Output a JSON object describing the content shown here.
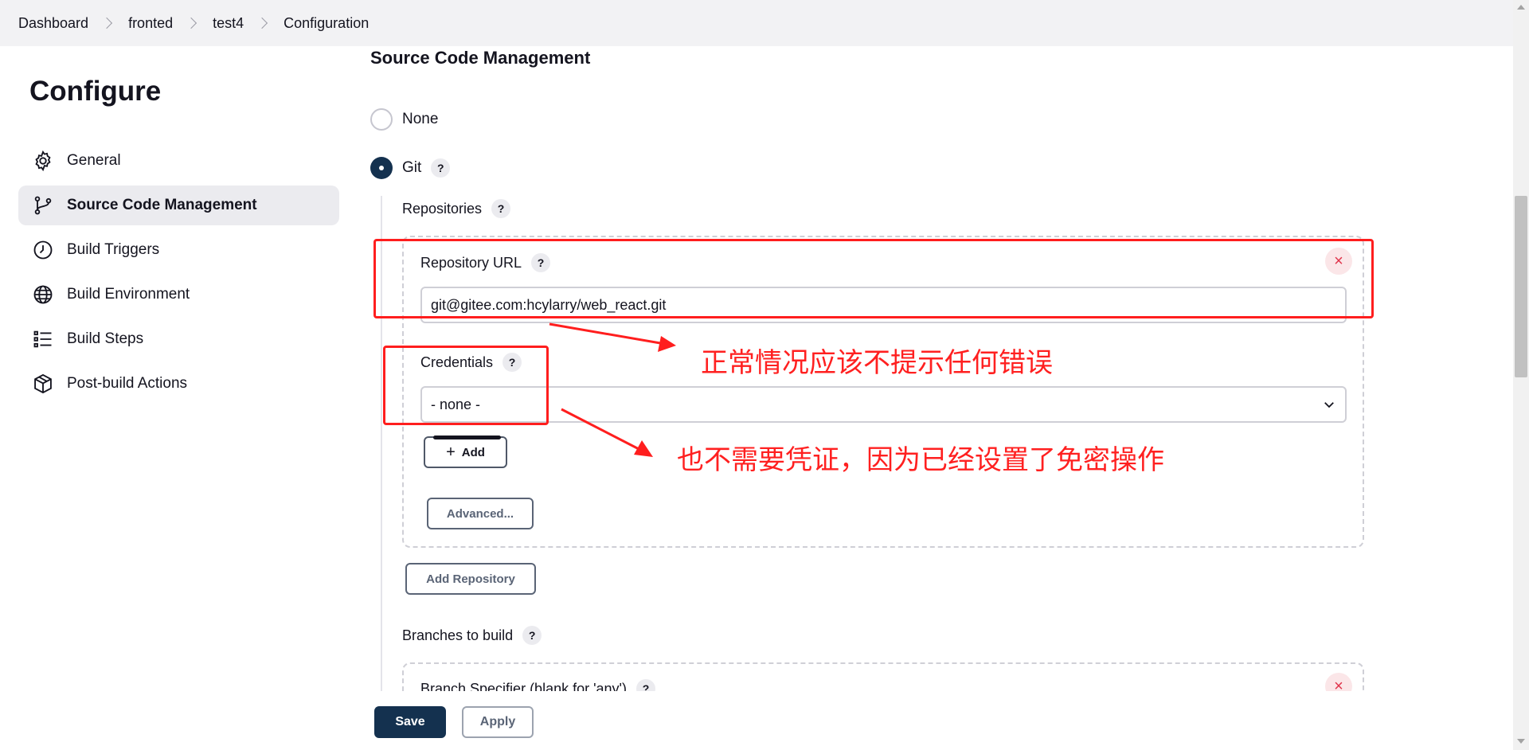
{
  "breadcrumb": [
    "Dashboard",
    "fronted",
    "test4",
    "Configuration"
  ],
  "page_title": "Configure",
  "sidebar": {
    "items": [
      {
        "label": "General",
        "icon": "gear-icon"
      },
      {
        "label": "Source Code Management",
        "icon": "git-branch-icon",
        "active": true
      },
      {
        "label": "Build Triggers",
        "icon": "clock-icon"
      },
      {
        "label": "Build Environment",
        "icon": "globe-icon"
      },
      {
        "label": "Build Steps",
        "icon": "list-icon"
      },
      {
        "label": "Post-build Actions",
        "icon": "package-icon"
      }
    ]
  },
  "scm": {
    "title": "Source Code Management",
    "option_none": "None",
    "option_git": "Git",
    "selected": "Git",
    "repositories_label": "Repositories",
    "repository_url_label": "Repository URL",
    "repository_url_value": "git@gitee.com:hcylarry/web_react.git",
    "credentials_label": "Credentials",
    "credentials_value": "- none -",
    "add_label": "Add",
    "advanced_label": "Advanced...",
    "add_repository_label": "Add Repository",
    "branches_label": "Branches to build",
    "branch_specifier_label": "Branch Specifier (blank for 'any')",
    "help_glyph": "?",
    "close_glyph": "×"
  },
  "footer": {
    "save_label": "Save",
    "apply_label": "Apply"
  },
  "annotations": {
    "note1": "正常情况应该不提示任何错误",
    "note2": "也不需要凭证，因为已经设置了免密操作",
    "color": "#ff1e1e"
  },
  "colors": {
    "primary": "#14314f",
    "topbar_bg": "#f2f2f4",
    "active_item_bg": "#ebebef"
  }
}
